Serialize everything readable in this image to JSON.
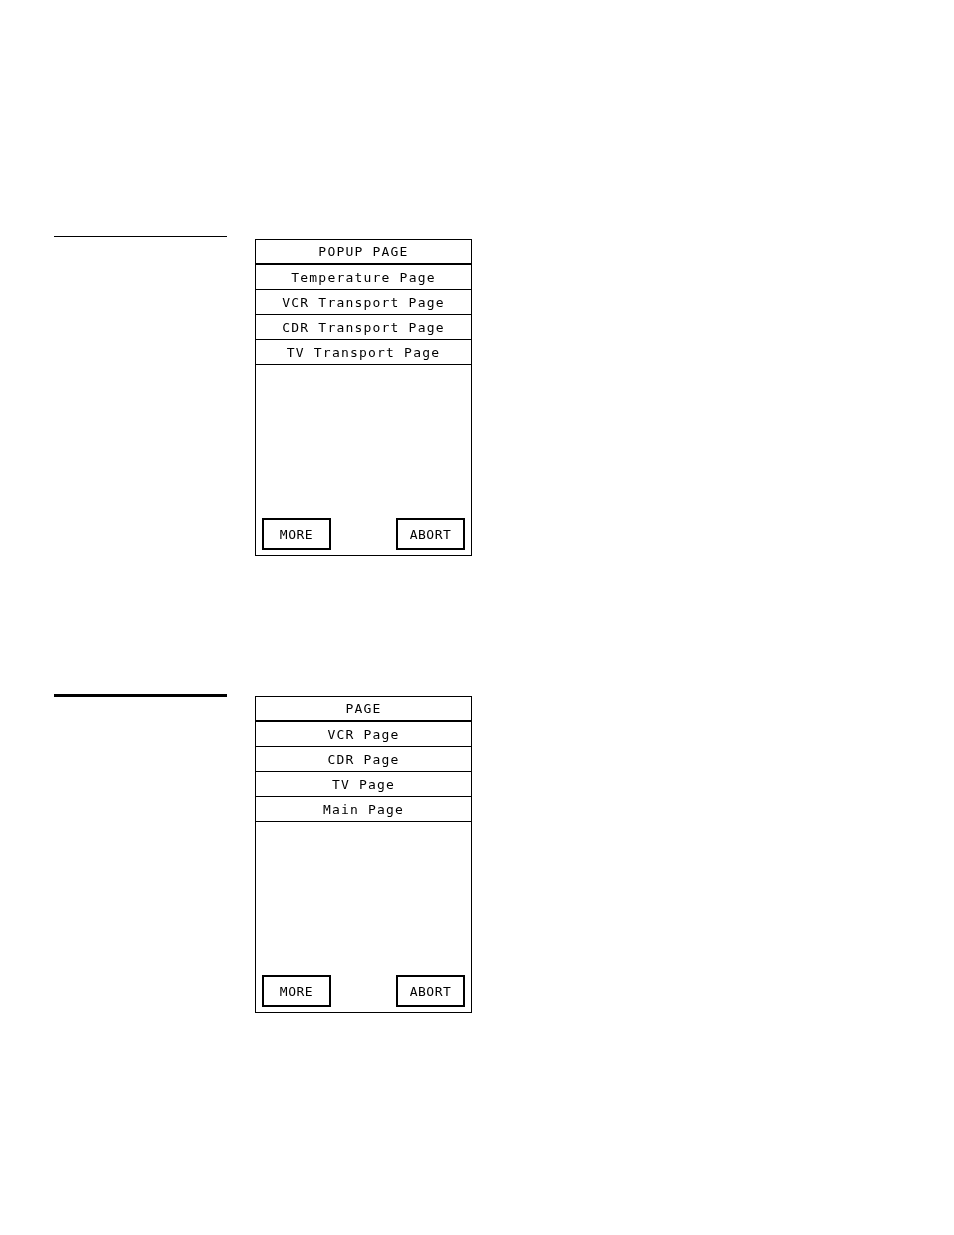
{
  "panels": [
    {
      "title": "POPUP PAGE",
      "items": [
        "Temperature Page",
        "VCR Transport Page",
        "CDR Transport Page",
        "TV Transport Page"
      ],
      "buttons": [
        "MORE",
        "ABORT"
      ]
    },
    {
      "title": "PAGE",
      "items": [
        "VCR Page",
        "CDR Page",
        "TV Page",
        "Main Page"
      ],
      "buttons": [
        "MORE",
        "ABORT"
      ]
    }
  ]
}
